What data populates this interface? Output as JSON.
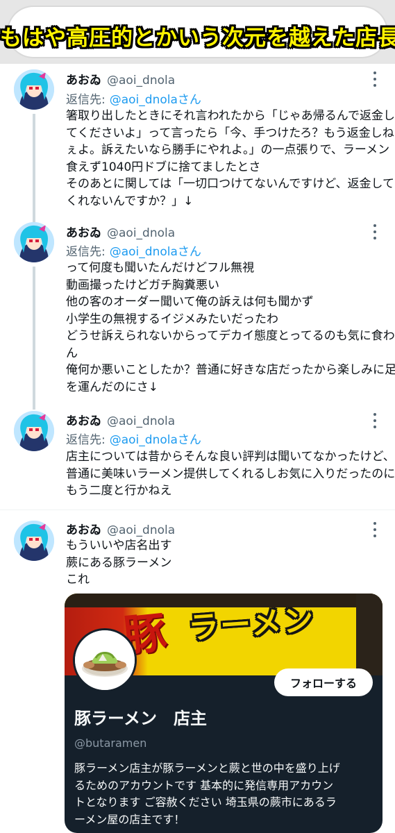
{
  "headline": "もはや高圧的とかいう次元を越えた店長",
  "tweets": [
    {
      "display_name": "あおゐ",
      "handle": "@aoi_dnola",
      "reply_prefix": "返信先:",
      "reply_to": "@aoi_dnolaさん",
      "lines": [
        "箸取り出したときにそれ言われたから「じゃあ帰るんで返金し",
        "てくださいよ」って言ったら「今、手つけたろ？もう返金しね",
        "ぇよ。訴えたいなら勝手にやれよ。」の一点張りで、ラーメン",
        "食えず1040円ドブに捨てましたとさ",
        "そのあとに関しては「一切口つけてないんですけど、返金して",
        "くれないんですか？」↓"
      ]
    },
    {
      "display_name": "あおゐ",
      "handle": "@aoi_dnola",
      "reply_prefix": "返信先:",
      "reply_to": "@aoi_dnolaさん",
      "lines": [
        "って何度も聞いたんだけどフル無視",
        "動画撮ったけどガチ胸糞悪い",
        "他の客のオーダー聞いて俺の訴えは何も聞かず",
        "小学生の無視するイジメみたいだったわ",
        "どうせ訴えられないからってデカイ態度とってるのも気に食わ",
        "ん",
        "俺何か悪いことしたか？普通に好きな店だったから楽しみに足",
        "を運んだのにさ↓"
      ]
    },
    {
      "display_name": "あおゐ",
      "handle": "@aoi_dnola",
      "reply_prefix": "返信先:",
      "reply_to": "@aoi_dnolaさん",
      "lines": [
        "店主については昔からそんな良い評判は聞いてなかったけど、",
        "普通に美味いラーメン提供してくれるしお気に入りだったのに",
        "もう二度と行かねえ"
      ]
    },
    {
      "display_name": "あおゐ",
      "handle": "@aoi_dnola",
      "lines": [
        "もういいや店名出す",
        "蕨にある豚ラーメン",
        "これ"
      ]
    }
  ],
  "card": {
    "banner_kanji": "豚",
    "banner_title": "ラーメン",
    "follow_label": "フォローする",
    "name": "豚ラーメン　店主",
    "handle": "@butaramen",
    "bio_lines": [
      "豚ラーメン店主が豚ラーメンと蕨と世の中を盛り上げ",
      "るためのアカウントです 基本的に発信専用アカウン",
      "トとなります ご容赦ください 埼玉県の蕨市にあるラ",
      "ーメン屋の店主です！"
    ]
  },
  "colors": {
    "headline_fill": "#fff400",
    "link_blue": "#1d9bf0",
    "card_background": "#15202b",
    "thread_line": "#cfd9de"
  },
  "icons": [
    "more-options-icon",
    "user-avatar",
    "ramen-bowl-avatar"
  ]
}
